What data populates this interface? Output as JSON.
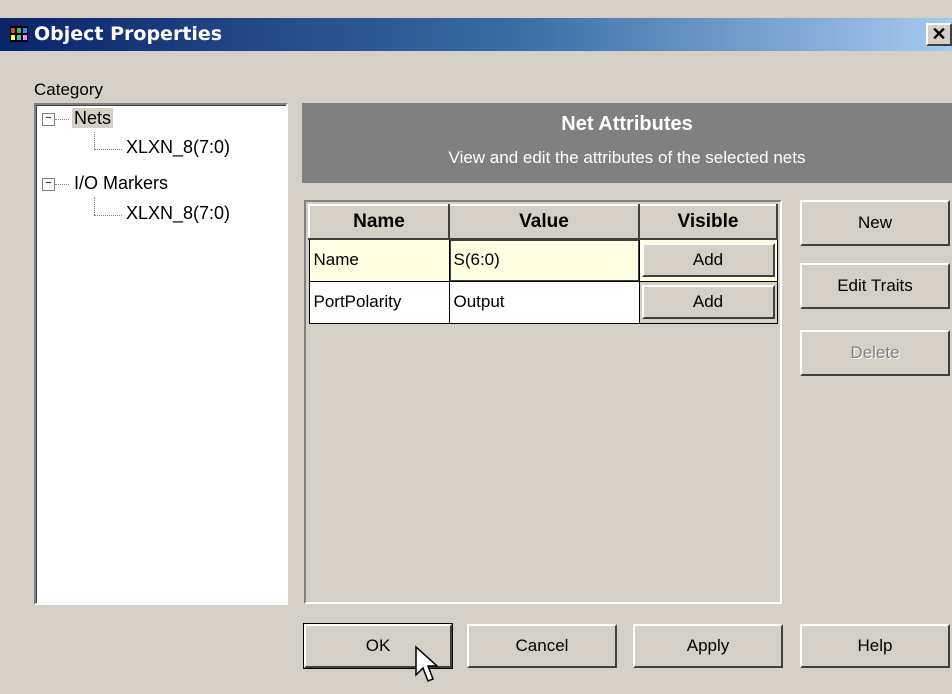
{
  "window": {
    "title": "Object Properties",
    "close_glyph": "✕"
  },
  "category": {
    "label": "Category",
    "tree": [
      {
        "label": "Nets",
        "expander": "−",
        "children": [
          "XLXN_8(7:0)"
        ]
      },
      {
        "label": "I/O Markers",
        "expander": "−",
        "children": [
          "XLXN_8(7:0)"
        ]
      }
    ]
  },
  "header": {
    "title": "Net Attributes",
    "subtitle": "View and edit the attributes of the selected nets"
  },
  "table": {
    "columns": [
      "Name",
      "Value",
      "Visible"
    ],
    "rows": [
      {
        "name": "Name",
        "value": "S(6:0)",
        "visible": "Add"
      },
      {
        "name": "PortPolarity",
        "value": "Output",
        "visible": "Add"
      }
    ]
  },
  "side_buttons": {
    "new": "New",
    "edit_traits": "Edit Traits",
    "delete": "Delete"
  },
  "footer_buttons": {
    "ok": "OK",
    "cancel": "Cancel",
    "apply": "Apply",
    "help": "Help"
  },
  "colors": {
    "titlebar_start": "#0a246a",
    "titlebar_end": "#a6caf0",
    "selected_row": "#ffffe1",
    "header_bg": "#808080"
  }
}
